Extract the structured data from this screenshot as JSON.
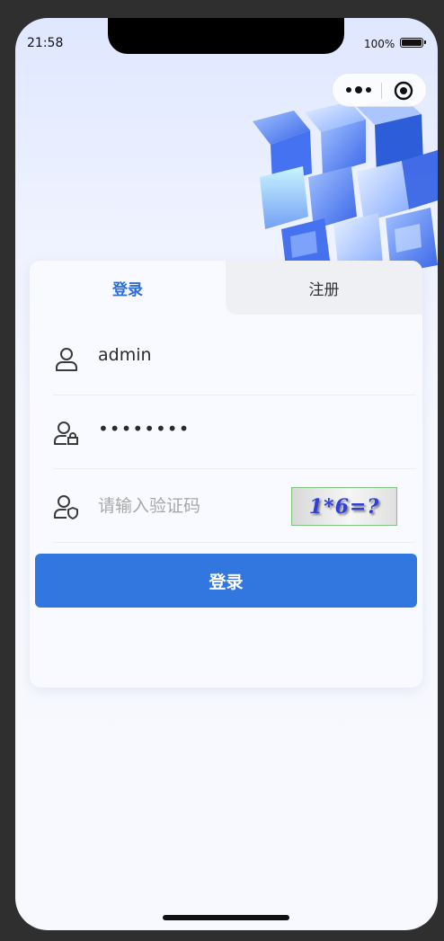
{
  "status_bar": {
    "time": "21:58",
    "battery": "100%"
  },
  "tabs": {
    "login": "登录",
    "register": "注册"
  },
  "form": {
    "username": "admin",
    "password_masked": "••••••••",
    "captcha_placeholder": "请输入验证码",
    "captcha_image_text": "1*6=?"
  },
  "actions": {
    "login_button": "登录"
  },
  "colors": {
    "accent": "#3276e0",
    "tab_active": "#2c6dd6",
    "tab_inactive_bg": "#eff0f3"
  },
  "icons": [
    "more-icon",
    "target-icon",
    "user-icon",
    "user-lock-icon",
    "user-shield-icon"
  ]
}
